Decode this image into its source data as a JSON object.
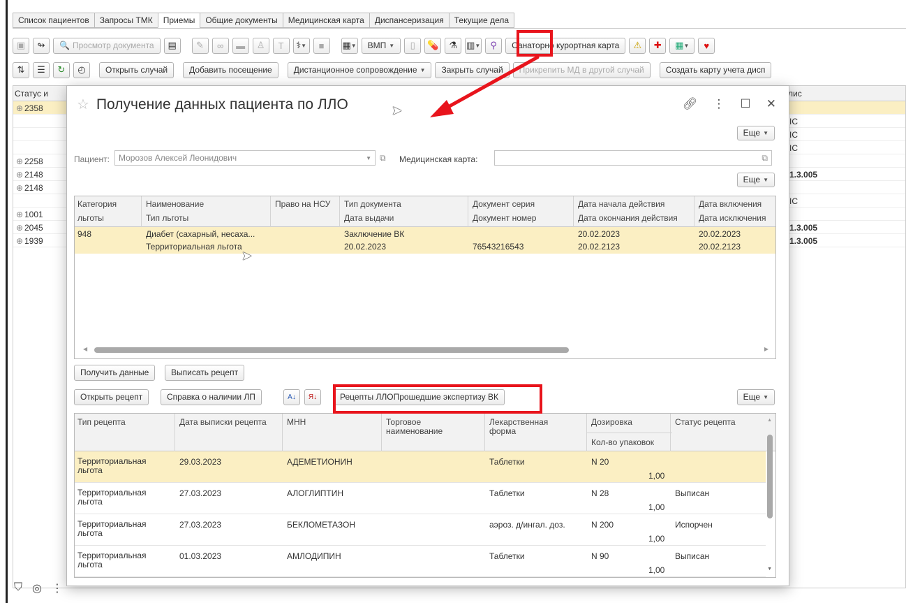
{
  "tabs": [
    "Список пациентов",
    "Запросы ТМК",
    "Приемы",
    "Общие документы",
    "Медицинская карта",
    "Диспансеризация",
    "Текущие дела"
  ],
  "toolbar1": {
    "view_doc": "Просмотр документа",
    "vmp": "ВМП",
    "sanatorium": "Санаторно курортная карта"
  },
  "toolbar2": {
    "open_case": "Открыть случай",
    "add_visit": "Добавить посещение",
    "remote": "Дистанционное сопровождение",
    "close_case": "Закрыть случай",
    "attach_md": "Прикрепить МД в другой случай",
    "create_card": "Создать карту учета дисп"
  },
  "background": {
    "col_status": "Статус и",
    "col_polis": "лис",
    "rows": [
      {
        "id": "2358",
        "right": "",
        "hl": true
      },
      {
        "id": "",
        "right": "ІС"
      },
      {
        "id": "",
        "right": "ІС"
      },
      {
        "id": "",
        "right": "ІС"
      },
      {
        "id": "2258",
        "right": ""
      },
      {
        "id": "2148",
        "right": "1.3.005"
      },
      {
        "id": "2148",
        "right": ""
      },
      {
        "id": "",
        "right": "ІС"
      },
      {
        "id": "1001",
        "right": ""
      },
      {
        "id": "2045",
        "right": "1.3.005"
      },
      {
        "id": "1939",
        "right": "1.3.005"
      }
    ]
  },
  "modal": {
    "title": "Получение данных пациента по ЛЛО",
    "more": "Еще",
    "patient_label": "Пациент:",
    "patient_value": "Морозов Алексей Леонидович",
    "medcard_label": "Медицинская карта:",
    "benefits": {
      "headers_top": [
        "Категория",
        "Наименование",
        "Право на НСУ",
        "Тип документа",
        "Документ серия",
        "Дата начала действия",
        "Дата включения"
      ],
      "headers_bottom": [
        "льготы",
        "Тип льготы",
        "",
        "Дата выдачи",
        "Документ номер",
        "Дата окончания действия",
        "Дата исключения"
      ],
      "row_top": [
        "948",
        "Диабет (сахарный, несаха...",
        "",
        "Заключение ВК",
        "",
        "20.02.2023",
        "20.02.2023"
      ],
      "row_bottom": [
        "",
        "Территориальная льгота",
        "",
        "20.02.2023",
        "76543216543",
        "20.02.2123",
        "20.02.2123"
      ]
    },
    "get_data": "Получить данные",
    "write_rx": "Выписать рецепт",
    "open_rx": "Открыть рецепт",
    "drug_info": "Справка о наличии ЛП",
    "rx_vk": "Рецепты ЛЛОПрошедшие экспертизу ВК",
    "rx": {
      "headers": [
        "Тип рецепта",
        "Дата выписки рецепта",
        "МНН",
        "Торговое наименование",
        "Лекарственная форма",
        "Дозировка",
        "Статус рецепта"
      ],
      "sub_header": "Кол-во упаковок",
      "rows": [
        {
          "type": "Территориальная льгота",
          "date": "29.03.2023",
          "mnn": "АДЕМЕТИОНИН",
          "trade": "",
          "form": "Таблетки",
          "dose": "N 20",
          "qty": "1,00",
          "status": ""
        },
        {
          "type": "Территориальная льгота",
          "date": "27.03.2023",
          "mnn": "АЛОГЛИПТИН",
          "trade": "",
          "form": "Таблетки",
          "dose": "N 28",
          "qty": "1,00",
          "status": "Выписан"
        },
        {
          "type": "Территориальная льгота",
          "date": "27.03.2023",
          "mnn": "БЕКЛОМЕТАЗОН",
          "trade": "",
          "form": "аэроз. д/ингал. доз.",
          "dose": "N 200",
          "qty": "1,00",
          "status": "Испорчен"
        },
        {
          "type": "Территориальная льгота",
          "date": "01.03.2023",
          "mnn": "АМЛОДИПИН",
          "trade": "",
          "form": "Таблетки",
          "dose": "N 90",
          "qty": "1,00",
          "status": "Выписан"
        }
      ]
    }
  },
  "colors": {
    "highlight": "#fbefc3",
    "callout": "#e8141c"
  }
}
